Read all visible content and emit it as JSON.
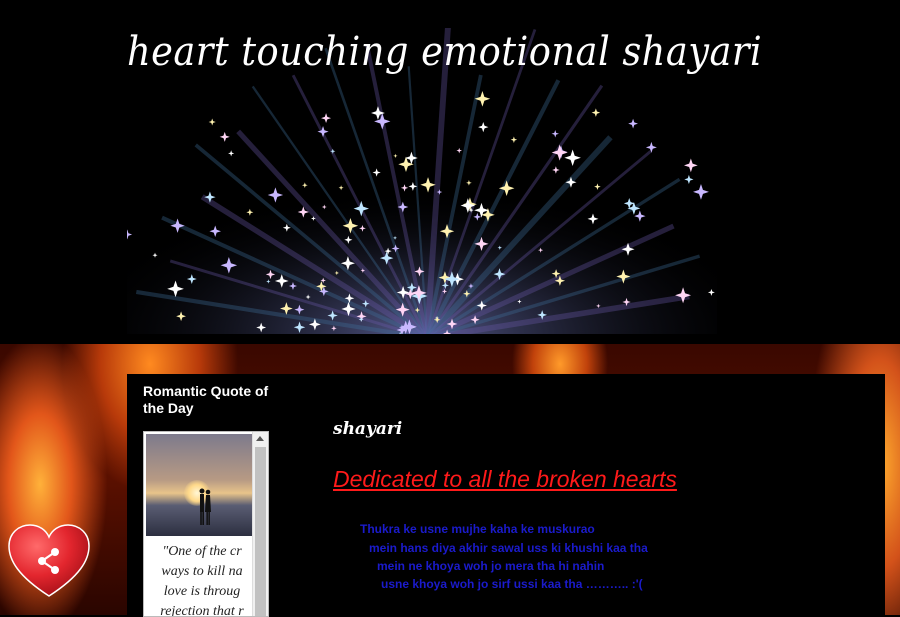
{
  "header": {
    "site_title": "heart touching emotional shayari"
  },
  "sidebar": {
    "widget_title": "Romantic Quote of the Day",
    "quote_lines": [
      "\"One of the cr",
      "ways to kill na",
      "love is throug",
      "rejection that r"
    ]
  },
  "post": {
    "label": "shayari",
    "headline": "Dedicated to all the broken hearts",
    "poem": [
      "Thukra ke usne mujhe kaha ke muskurao",
      "mein hans diya akhir sawal uss ki khushi kaa tha",
      "mein ne khoya woh jo mera tha hi nahin",
      "usne khoya woh jo sirf ussi kaa tha ……….. :'("
    ]
  },
  "share": {
    "icon": "share-icon"
  },
  "colors": {
    "headline": "#ff1a1a",
    "poem": "#1b1bcc",
    "panel": "#000000",
    "heart": "#e3262e"
  }
}
